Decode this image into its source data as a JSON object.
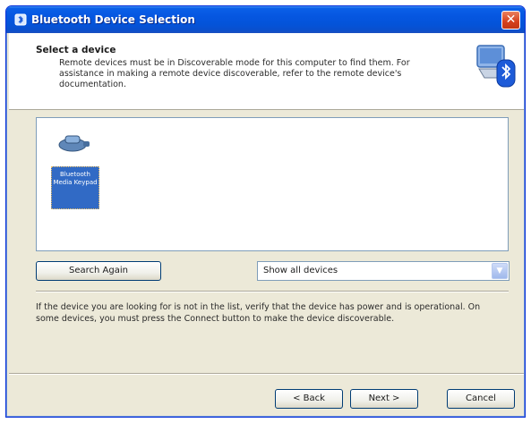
{
  "window": {
    "title": "Bluetooth Device Selection",
    "close_glyph": "✕",
    "title_icon": "bluetooth-icon"
  },
  "header": {
    "title": "Select a device",
    "description": "Remote devices must be in Discoverable mode for this computer to find them. For assistance in making a remote device discoverable, refer to the remote device's documentation.",
    "icon": "bluetooth-computer-icon"
  },
  "device_list": {
    "items": [
      {
        "label": "Bluetooth Media Keypad",
        "icon": "keypad-device-icon",
        "selected": true
      }
    ]
  },
  "controls": {
    "search_again_label": "Search Again",
    "filter_selected": "Show all devices",
    "dropdown_glyph": "▼"
  },
  "help": {
    "text": "If the device you are looking for is not in the list, verify that the device has power and is operational. On some devices, you must press the Connect button to make the device discoverable."
  },
  "footer": {
    "back_label": "< Back",
    "next_label": "Next >",
    "cancel_label": "Cancel"
  },
  "colors": {
    "titlebar": "#0556e0",
    "selection": "#316ac5",
    "close": "#d5401c",
    "dialog_bg": "#ece9d8"
  }
}
